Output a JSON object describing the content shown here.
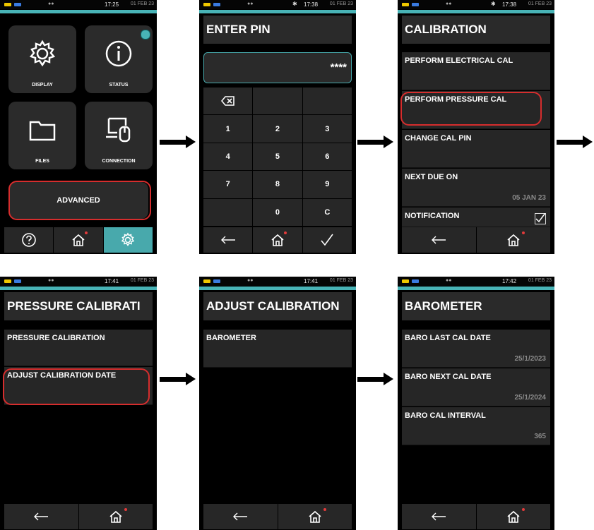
{
  "screens": [
    {
      "status": {
        "time": "17:25",
        "date": "01 FEB 23"
      },
      "tiles": [
        "DISPLAY",
        "STATUS",
        "FILES",
        "CONNECTION"
      ],
      "advanced_label": "ADVANCED"
    },
    {
      "status": {
        "time": "17:38",
        "date": "01 FEB 23"
      },
      "title": "ENTER PIN",
      "pin_value": "****",
      "keys": [
        "⌫",
        "",
        "",
        "1",
        "2",
        "3",
        "4",
        "5",
        "6",
        "7",
        "8",
        "9",
        "",
        "0",
        "C"
      ]
    },
    {
      "status": {
        "time": "17:38",
        "date": "01 FEB 23"
      },
      "title": "CALIBRATION",
      "items": [
        {
          "label": "PERFORM ELECTRICAL CAL",
          "value": ""
        },
        {
          "label": "PERFORM PRESSURE CAL",
          "value": ""
        },
        {
          "label": "CHANGE CAL PIN",
          "value": ""
        },
        {
          "label": "NEXT DUE ON",
          "value": "05 JAN 23"
        },
        {
          "label": "NOTIFICATION",
          "value": ""
        }
      ],
      "notification_checked": true
    },
    {
      "status": {
        "time": "17:41",
        "date": "01 FEB 23"
      },
      "title": "PRESSURE CALIBRATI",
      "items": [
        {
          "label": "PRESSURE CALIBRATION"
        },
        {
          "label": "ADJUST CALIBRATION DATE"
        }
      ]
    },
    {
      "status": {
        "time": "17:41",
        "date": "01 FEB 23"
      },
      "title": "ADJUST CALIBRATION",
      "items": [
        {
          "label": "BAROMETER"
        }
      ]
    },
    {
      "status": {
        "time": "17:42",
        "date": "01 FEB 23"
      },
      "title": "BAROMETER",
      "items": [
        {
          "label": "BARO LAST CAL DATE",
          "value": "25/1/2023"
        },
        {
          "label": "BARO NEXT CAL DATE",
          "value": "25/1/2024"
        },
        {
          "label": "BARO CAL INTERVAL",
          "value": "365"
        }
      ]
    }
  ],
  "icons": [
    "help-icon",
    "home-icon",
    "settings-icon",
    "back-arrow-icon",
    "checkmark-icon",
    "backspace-icon"
  ],
  "colors": {
    "accent": "#48b3b6",
    "highlight": "#d62d2d",
    "panel": "#2a2a2a"
  }
}
